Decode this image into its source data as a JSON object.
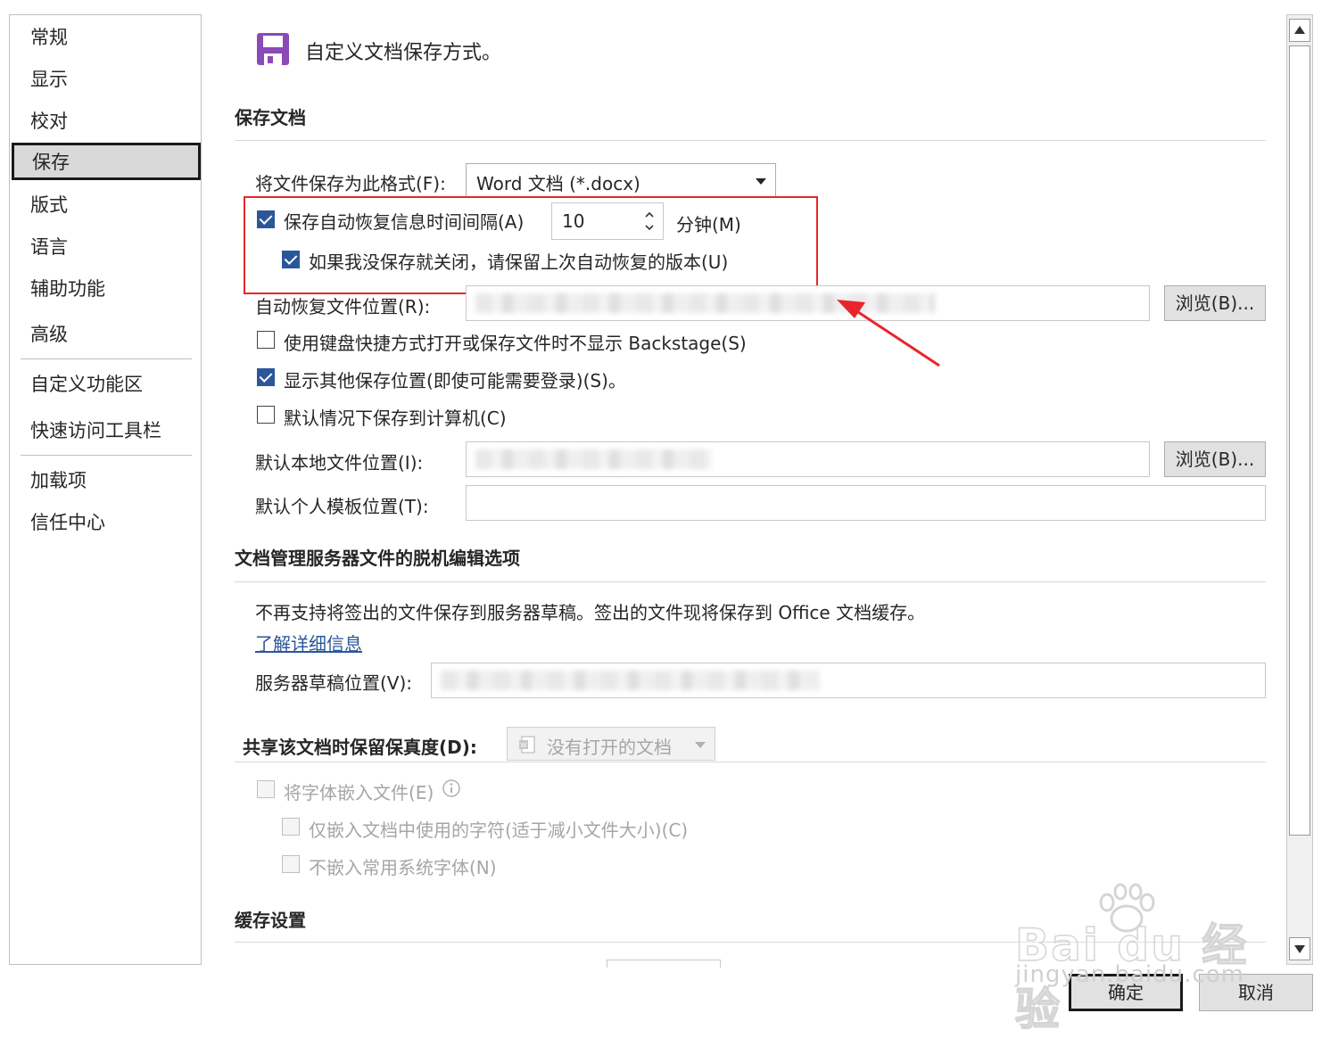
{
  "sidebar": {
    "items": [
      {
        "label": "常规"
      },
      {
        "label": "显示"
      },
      {
        "label": "校对"
      },
      {
        "label": "保存"
      },
      {
        "label": "版式"
      },
      {
        "label": "语言"
      },
      {
        "label": "辅助功能"
      },
      {
        "label": "高级"
      },
      {
        "label": "自定义功能区"
      },
      {
        "label": "快速访问工具栏"
      },
      {
        "label": "加载项"
      },
      {
        "label": "信任中心"
      }
    ],
    "active": "保存"
  },
  "header": {
    "title": "自定义文档保存方式。",
    "icon": "floppy-disk-icon"
  },
  "save_documents": {
    "title": "保存文档",
    "format_label": "将文件保存为此格式(F):",
    "format_value": "Word 文档 (*.docx)",
    "autorecover_label": "保存自动恢复信息时间间隔(A)",
    "autorecover_minutes": "10",
    "minutes_label": "分钟(M)",
    "keep_last_label": "如果我没保存就关闭，请保留上次自动恢复的版本(U)",
    "autorecover_location_label": "自动恢复文件位置(R):",
    "browse_label": "浏览(B)...",
    "no_backstage_label": "使用键盘快捷方式打开或保存文件时不显示 Backstage(S)",
    "show_other_locations_label": "显示其他保存位置(即使可能需要登录)(S)。",
    "save_to_computer_label": "默认情况下保存到计算机(C)",
    "local_location_label": "默认本地文件位置(I):",
    "template_location_label": "默认个人模板位置(T):"
  },
  "offline_editing": {
    "title": "文档管理服务器文件的脱机编辑选项",
    "notice": "不再支持将签出的文件保存到服务器草稿。签出的文件现将保存到 Office 文档缓存。",
    "learn_more": "了解详细信息",
    "drafts_location_label": "服务器草稿位置(V):"
  },
  "fidelity": {
    "title": "共享该文档时保留保真度(D):",
    "doc_select": "没有打开的文档",
    "embed_fonts_label": "将字体嵌入文件(E)",
    "embed_used_chars_label": "仅嵌入文档中使用的字符(适于减小文件大小)(C)",
    "no_common_fonts_label": "不嵌入常用系统字体(N)"
  },
  "cache": {
    "title": "缓存设置"
  },
  "footer": {
    "ok": "确定",
    "cancel": "取消"
  },
  "watermark": {
    "brand": "Bai du 经验",
    "url": "jingyan.baidu.com"
  },
  "colors": {
    "highlight": "#e8252a",
    "accent": "#2b579a",
    "icon": "#8a4ab8"
  }
}
